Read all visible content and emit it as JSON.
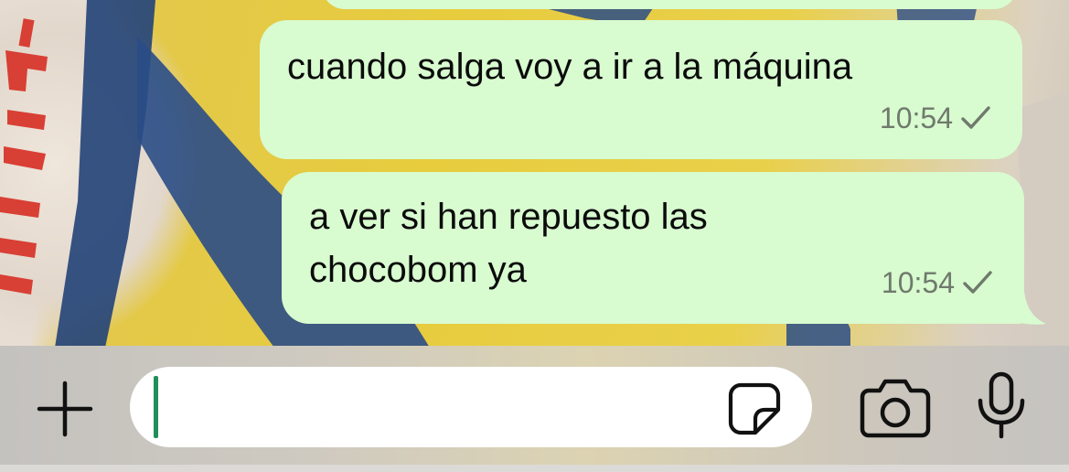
{
  "chat": {
    "messages": [
      {
        "text": "cuando salga voy a ir a la máquina",
        "time": "10:54",
        "status": "sent-check-icon"
      },
      {
        "text": "a ver si han repuesto las\nchocobom ya",
        "time": "10:54",
        "status": "sent-check-icon"
      }
    ],
    "bubble_color": "#d8fbd0"
  },
  "composer": {
    "input_value": "",
    "cursor_color": "#1f8f5a",
    "icons": {
      "add": "plus-icon",
      "sticker": "sticker-icon",
      "camera": "camera-icon",
      "voice": "microphone-icon"
    }
  }
}
